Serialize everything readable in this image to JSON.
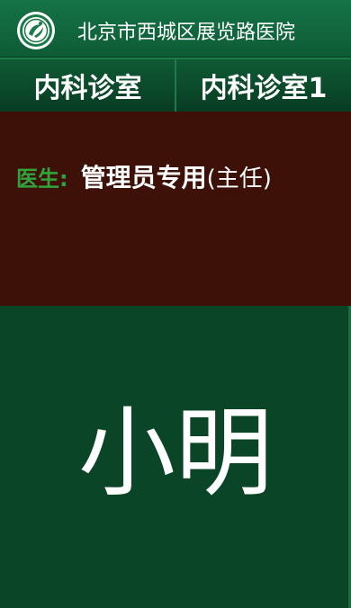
{
  "header": {
    "hospital_name": "北京市西城区展览路医院",
    "logo_icon": "hospital-logo-icon"
  },
  "tabs": [
    {
      "label": "内科诊室"
    },
    {
      "label": "内科诊室1"
    }
  ],
  "doctor": {
    "label": "医生:",
    "name": "管理员专用",
    "title": "(主任)"
  },
  "patient": {
    "name": "小明"
  },
  "colors": {
    "header_green": "#157347",
    "body_green": "#0b4527",
    "doctor_panel": "#3e1108",
    "doctor_label": "#2fa43a"
  }
}
